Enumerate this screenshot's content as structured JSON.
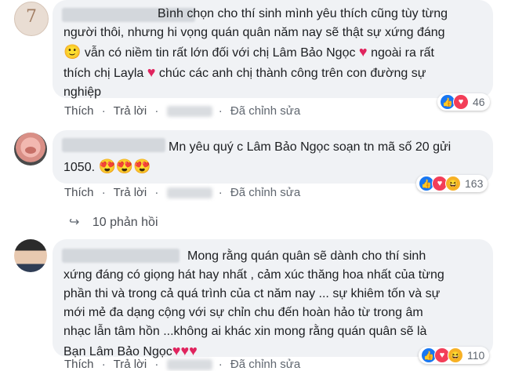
{
  "comments": [
    {
      "text_line1": "Bình chọn cho thí sinh mình yêu thích cũng tùy từng",
      "text_line2": "người thôi, nhưng hi vọng quán quân năm nay sẽ thật sự xứng đáng",
      "text_line3a": "vẫn có niềm tin rất lớn đối với chị Lâm Bảo Ngọc",
      "text_line3b": "ngoài ra rất",
      "text_line4a": "thích chị Layla",
      "text_line4b": "chúc các anh chị thành công trên con đường sự",
      "text_line5": "nghiệp",
      "emoji_smile": "🙂",
      "heart": "♥",
      "avatar_label": "7",
      "like": "Thích",
      "reply": "Trả lời",
      "edited": "Đã chỉnh sửa",
      "reaction_count": "46",
      "reactions": [
        "like-icon",
        "love-icon"
      ]
    },
    {
      "text_line1": "Mn yêu quý c Lâm Bảo Ngọc soạn tn mã số 20 gửi",
      "text_line2": "1050.",
      "emojis": "😍😍😍",
      "like": "Thích",
      "reply": "Trả lời",
      "edited": "Đã chỉnh sửa",
      "reaction_count": "163",
      "reactions": [
        "like-icon",
        "love-icon",
        "haha-icon"
      ],
      "replies_label": "10 phản hồi"
    },
    {
      "text_line1": "Mong rằng quán quân sẽ dành cho thí sinh",
      "text_line2": "xứng đáng có giọng hát hay nhất , cảm xúc thăng hoa nhất của từng",
      "text_line3": "phần thi và trong cả quá trình của ct năm nay ... sự khiêm tốn và sự",
      "text_line4": "mới mẻ đa dạng cộng với sự chỉn chu đến hoàn hảo từ trong âm",
      "text_line5": "nhạc lẫn tâm hồn ...không ai khác xin mong rằng quán quân sẽ là",
      "text_line6": "Bạn Lâm Bảo Ngọc",
      "hearts": "♥♥♥",
      "like": "Thích",
      "reply": "Trả lời",
      "edited": "Đã chỉnh sửa",
      "reaction_count": "110",
      "reactions": [
        "like-icon",
        "love-icon",
        "haha-icon"
      ]
    }
  ],
  "colors": {
    "bubble": "#f0f2f5",
    "like": "#1877f2",
    "love": "#f33e58",
    "haha": "#f7b125",
    "text": "#1c1e21",
    "muted": "#606770"
  }
}
